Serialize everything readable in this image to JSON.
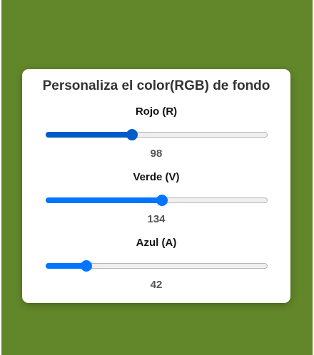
{
  "background_color": "#62862a",
  "accent_colors": {
    "active_fill": "#005cc8",
    "fill": "#0075ff"
  },
  "title": "Personaliza el color(RGB) de fondo",
  "sliders": [
    {
      "id": "red",
      "label": "Rojo (R)",
      "value": "98",
      "level": 0.3843,
      "active": true
    },
    {
      "id": "green",
      "label": "Verde (V)",
      "value": "134",
      "level": 0.5255,
      "active": false
    },
    {
      "id": "blue",
      "label": "Azul (A)",
      "value": "42",
      "level": 0.1647,
      "active": false
    }
  ]
}
